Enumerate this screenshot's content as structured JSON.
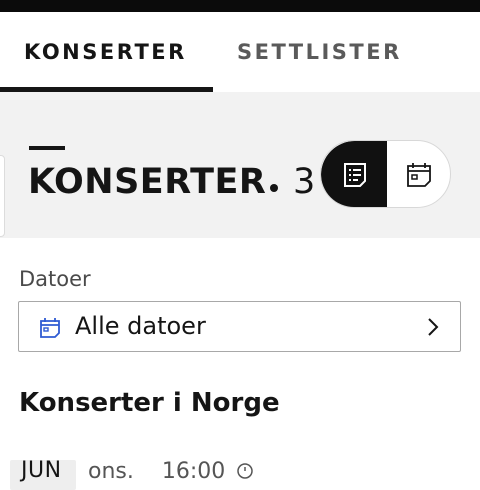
{
  "tabs": [
    {
      "label": "KONSERTER",
      "active": true
    },
    {
      "label": "SETTLISTER",
      "active": false
    }
  ],
  "section": {
    "title": "KONSERTER",
    "count": "3",
    "view_toggle": {
      "list_icon": "list-icon",
      "calendar_icon": "calendar-icon",
      "selected": "list"
    }
  },
  "filter": {
    "label": "Datoer",
    "value": "Alle datoer",
    "icon": "calendar-icon"
  },
  "list": {
    "heading": "Konserter i Norge",
    "first_event": {
      "month": "JUN",
      "weekday": "ons.",
      "time": "16:00"
    }
  },
  "colors": {
    "accent": "#2f5bd3",
    "text": "#151515",
    "section_bg": "#f2f2f2"
  }
}
